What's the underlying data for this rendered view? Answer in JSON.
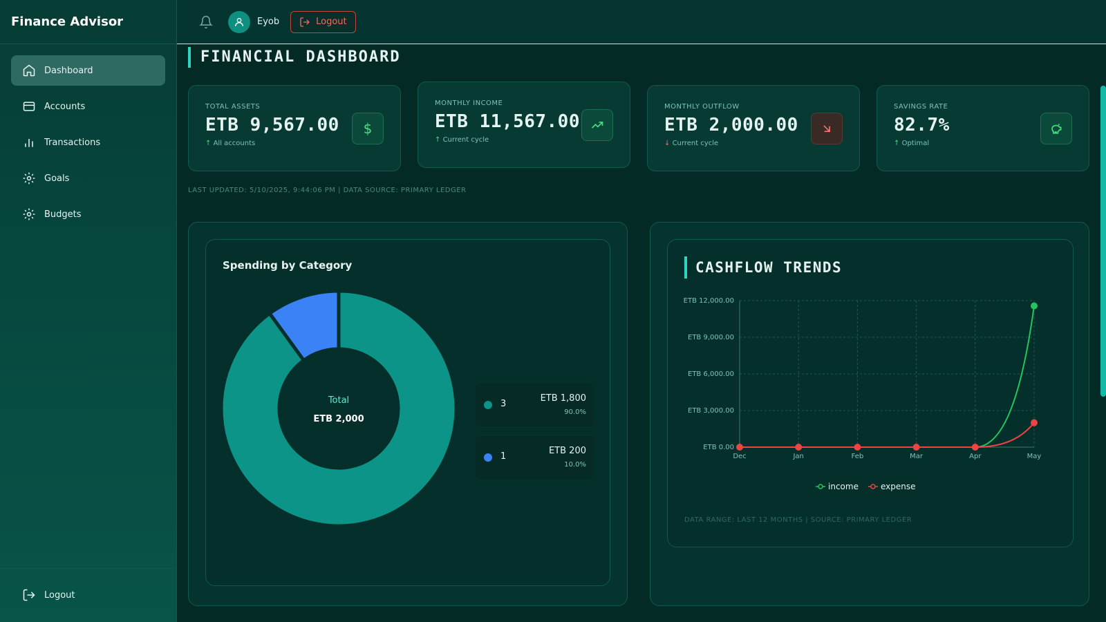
{
  "app": {
    "title": "Finance Advisor"
  },
  "sidebar": {
    "items": [
      {
        "label": "Dashboard",
        "icon": "home-icon",
        "active": true
      },
      {
        "label": "Accounts",
        "icon": "card-icon"
      },
      {
        "label": "Transactions",
        "icon": "bar-chart-icon"
      },
      {
        "label": "Goals",
        "icon": "gear-icon"
      },
      {
        "label": "Budgets",
        "icon": "gear-icon"
      }
    ],
    "logout_label": "Logout"
  },
  "topbar": {
    "username": "Eyob",
    "logout_label": "Logout"
  },
  "page": {
    "title": "FINANCIAL DASHBOARD"
  },
  "stats": [
    {
      "label": "TOTAL ASSETS",
      "value": "ETB 9,567.00",
      "sub": "All accounts",
      "trend": "up",
      "icon": "dollar-icon"
    },
    {
      "label": "MONTHLY INCOME",
      "value": "ETB 11,567.00",
      "sub": "Current cycle",
      "trend": "up",
      "icon": "trending-up-icon"
    },
    {
      "label": "MONTHLY OUTFLOW",
      "value": "ETB 2,000.00",
      "sub": "Current cycle",
      "trend": "down",
      "icon": "arrow-down-right-icon"
    },
    {
      "label": "SAVINGS RATE",
      "value": "82.7%",
      "sub": "Optimal",
      "trend": "up",
      "icon": "piggy-bank-icon"
    }
  ],
  "updated_text": "LAST UPDATED: 5/10/2025, 9:44:06 PM | DATA SOURCE: PRIMARY LEDGER",
  "spending": {
    "title": "Spending by Category",
    "center_label": "Total",
    "center_value": "ETB 2,000",
    "items": [
      {
        "name": "3",
        "amount": "ETB 1,800",
        "pct": "90.0%",
        "value": 1800,
        "color": "#0d9488"
      },
      {
        "name": "1",
        "amount": "ETB 200",
        "pct": "10.0%",
        "value": 200,
        "color": "#3b82f6"
      }
    ]
  },
  "cashflow": {
    "title": "CASHFLOW TRENDS",
    "footer": "DATA RANGE: LAST 12 MONTHS | SOURCE: PRIMARY LEDGER"
  },
  "chart_data": {
    "type": "line",
    "x": [
      "Dec",
      "Jan",
      "Feb",
      "Mar",
      "Apr",
      "May"
    ],
    "yticks": [
      "ETB 0.00",
      "ETB 3,000.00",
      "ETB 6,000.00",
      "ETB 9,000.00",
      "ETB 12,000.00"
    ],
    "ylim": [
      0,
      12000
    ],
    "series": [
      {
        "name": "income",
        "values": [
          0,
          0,
          0,
          0,
          0,
          11567
        ],
        "color": "#22c55e"
      },
      {
        "name": "expense",
        "values": [
          0,
          0,
          0,
          0,
          0,
          2000
        ],
        "color": "#ef4444"
      }
    ],
    "grid": true,
    "legend": "bottom"
  }
}
